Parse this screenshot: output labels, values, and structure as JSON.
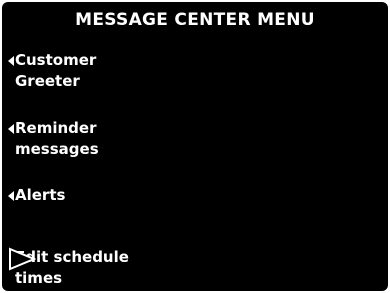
{
  "header": {
    "title": "MESSAGE CENTER MENU"
  },
  "menu": {
    "items": [
      {
        "line1": "Customer",
        "line2": "Greeter",
        "icon": "left-arrow-icon"
      },
      {
        "line1": "Reminder",
        "line2": "messages",
        "icon": "left-arrow-icon"
      },
      {
        "line1": "Alerts",
        "line2": "",
        "icon": "left-arrow-icon"
      },
      {
        "line1": "Edit schedule",
        "line2": "times",
        "icon": "pointer-arrow-icon"
      }
    ]
  },
  "colors": {
    "screen_background": "#000000",
    "text": "#ffffff",
    "pointer": "#ffffff"
  }
}
